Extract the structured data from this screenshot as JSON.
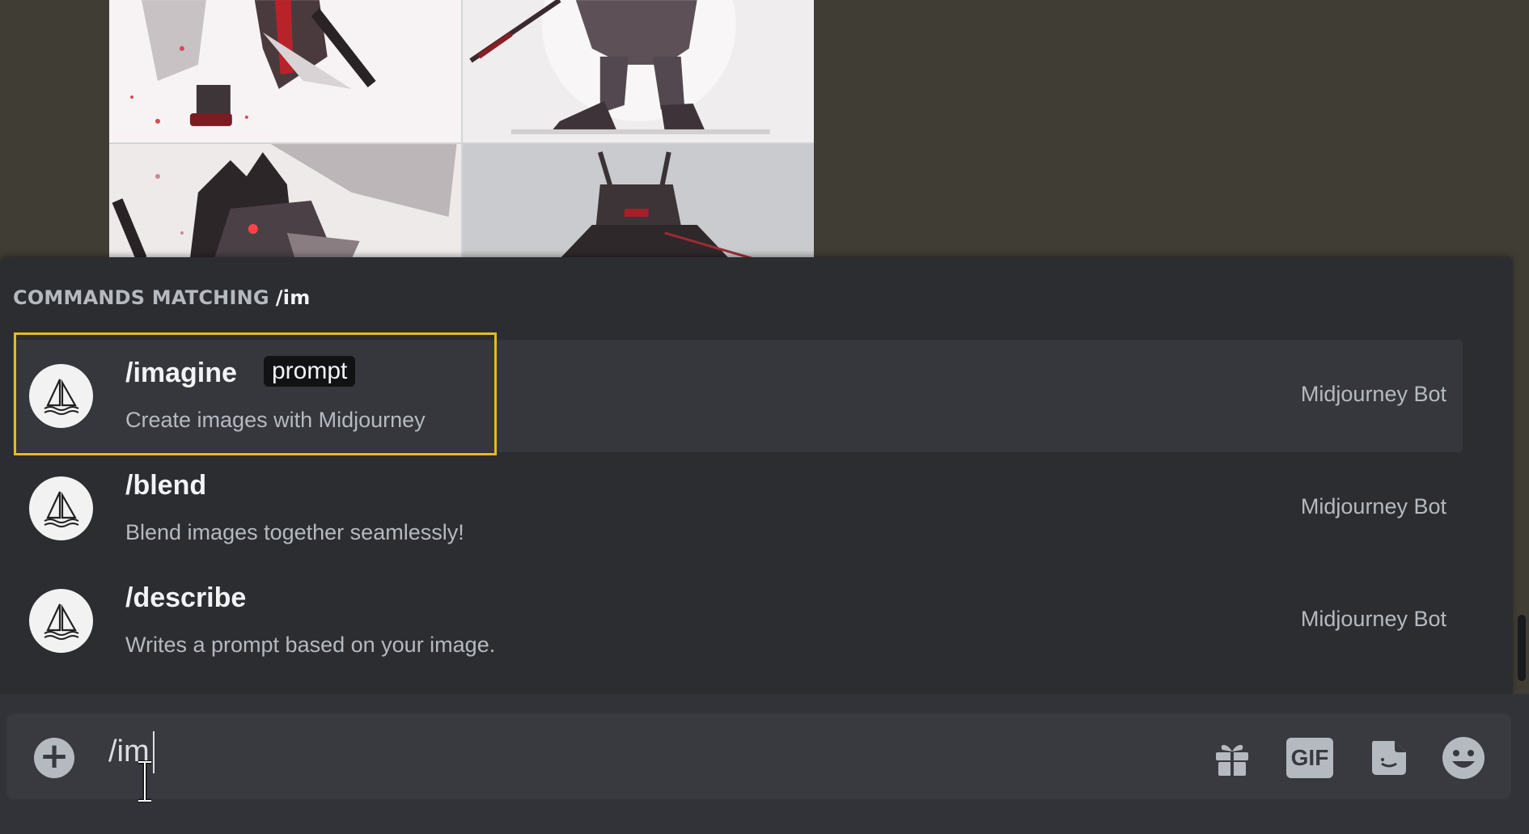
{
  "autocomplete": {
    "header_label": "COMMANDS MATCHING",
    "query": "/im",
    "commands": [
      {
        "name": "/imagine",
        "param": "prompt",
        "description": "Create images with Midjourney",
        "source": "Midjourney Bot",
        "avatar_icon": "sailboat-icon"
      },
      {
        "name": "/blend",
        "param": "",
        "description": "Blend images together seamlessly!",
        "source": "Midjourney Bot",
        "avatar_icon": "sailboat-icon"
      },
      {
        "name": "/describe",
        "param": "",
        "description": "Writes a prompt based on your image.",
        "source": "Midjourney Bot",
        "avatar_icon": "sailboat-icon"
      }
    ],
    "selected_index": 0,
    "highlight_color": "#e8b923"
  },
  "composer": {
    "value": "/im",
    "attach_icon": "plus-icon",
    "tools": {
      "gift_icon": "gift-icon",
      "gif_label": "GIF",
      "sticker_icon": "sticker-icon",
      "emoji_icon": "smiley-emoji-icon"
    }
  },
  "image_grid": {
    "tiles": [
      "armored-samurai-image",
      "mech-warrior-image",
      "masked-samurai-image",
      "helmet-warrior-image"
    ]
  },
  "colors": {
    "panel_bg": "#2b2d31",
    "selected_row_bg": "#35373c",
    "input_bg": "#383a40"
  }
}
